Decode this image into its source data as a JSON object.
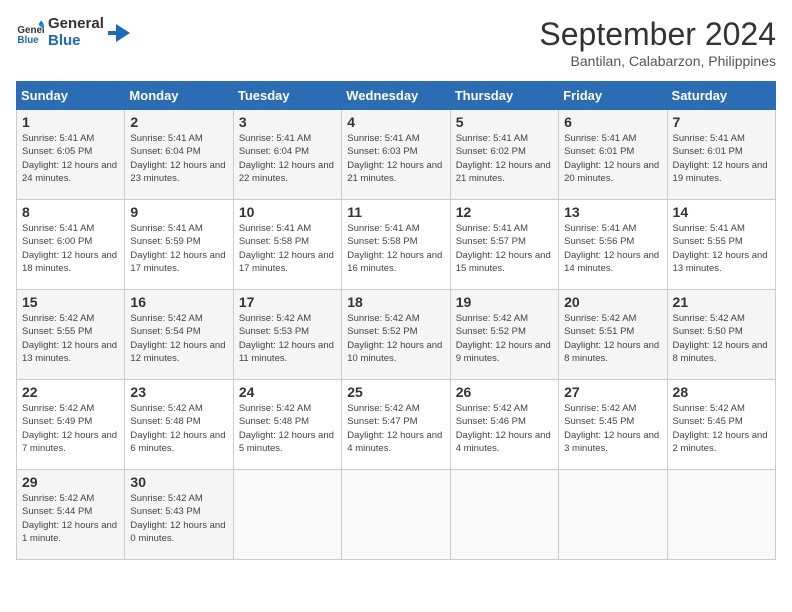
{
  "header": {
    "logo_line1": "General",
    "logo_line2": "Blue",
    "month": "September 2024",
    "location": "Bantilan, Calabarzon, Philippines"
  },
  "weekdays": [
    "Sunday",
    "Monday",
    "Tuesday",
    "Wednesday",
    "Thursday",
    "Friday",
    "Saturday"
  ],
  "weeks": [
    [
      {
        "day": "1",
        "sunrise": "5:41 AM",
        "sunset": "6:05 PM",
        "daylight": "12 hours and 24 minutes."
      },
      {
        "day": "2",
        "sunrise": "5:41 AM",
        "sunset": "6:04 PM",
        "daylight": "12 hours and 23 minutes."
      },
      {
        "day": "3",
        "sunrise": "5:41 AM",
        "sunset": "6:04 PM",
        "daylight": "12 hours and 22 minutes."
      },
      {
        "day": "4",
        "sunrise": "5:41 AM",
        "sunset": "6:03 PM",
        "daylight": "12 hours and 21 minutes."
      },
      {
        "day": "5",
        "sunrise": "5:41 AM",
        "sunset": "6:02 PM",
        "daylight": "12 hours and 21 minutes."
      },
      {
        "day": "6",
        "sunrise": "5:41 AM",
        "sunset": "6:01 PM",
        "daylight": "12 hours and 20 minutes."
      },
      {
        "day": "7",
        "sunrise": "5:41 AM",
        "sunset": "6:01 PM",
        "daylight": "12 hours and 19 minutes."
      }
    ],
    [
      {
        "day": "8",
        "sunrise": "5:41 AM",
        "sunset": "6:00 PM",
        "daylight": "12 hours and 18 minutes."
      },
      {
        "day": "9",
        "sunrise": "5:41 AM",
        "sunset": "5:59 PM",
        "daylight": "12 hours and 17 minutes."
      },
      {
        "day": "10",
        "sunrise": "5:41 AM",
        "sunset": "5:58 PM",
        "daylight": "12 hours and 17 minutes."
      },
      {
        "day": "11",
        "sunrise": "5:41 AM",
        "sunset": "5:58 PM",
        "daylight": "12 hours and 16 minutes."
      },
      {
        "day": "12",
        "sunrise": "5:41 AM",
        "sunset": "5:57 PM",
        "daylight": "12 hours and 15 minutes."
      },
      {
        "day": "13",
        "sunrise": "5:41 AM",
        "sunset": "5:56 PM",
        "daylight": "12 hours and 14 minutes."
      },
      {
        "day": "14",
        "sunrise": "5:41 AM",
        "sunset": "5:55 PM",
        "daylight": "12 hours and 13 minutes."
      }
    ],
    [
      {
        "day": "15",
        "sunrise": "5:42 AM",
        "sunset": "5:55 PM",
        "daylight": "12 hours and 13 minutes."
      },
      {
        "day": "16",
        "sunrise": "5:42 AM",
        "sunset": "5:54 PM",
        "daylight": "12 hours and 12 minutes."
      },
      {
        "day": "17",
        "sunrise": "5:42 AM",
        "sunset": "5:53 PM",
        "daylight": "12 hours and 11 minutes."
      },
      {
        "day": "18",
        "sunrise": "5:42 AM",
        "sunset": "5:52 PM",
        "daylight": "12 hours and 10 minutes."
      },
      {
        "day": "19",
        "sunrise": "5:42 AM",
        "sunset": "5:52 PM",
        "daylight": "12 hours and 9 minutes."
      },
      {
        "day": "20",
        "sunrise": "5:42 AM",
        "sunset": "5:51 PM",
        "daylight": "12 hours and 8 minutes."
      },
      {
        "day": "21",
        "sunrise": "5:42 AM",
        "sunset": "5:50 PM",
        "daylight": "12 hours and 8 minutes."
      }
    ],
    [
      {
        "day": "22",
        "sunrise": "5:42 AM",
        "sunset": "5:49 PM",
        "daylight": "12 hours and 7 minutes."
      },
      {
        "day": "23",
        "sunrise": "5:42 AM",
        "sunset": "5:48 PM",
        "daylight": "12 hours and 6 minutes."
      },
      {
        "day": "24",
        "sunrise": "5:42 AM",
        "sunset": "5:48 PM",
        "daylight": "12 hours and 5 minutes."
      },
      {
        "day": "25",
        "sunrise": "5:42 AM",
        "sunset": "5:47 PM",
        "daylight": "12 hours and 4 minutes."
      },
      {
        "day": "26",
        "sunrise": "5:42 AM",
        "sunset": "5:46 PM",
        "daylight": "12 hours and 4 minutes."
      },
      {
        "day": "27",
        "sunrise": "5:42 AM",
        "sunset": "5:45 PM",
        "daylight": "12 hours and 3 minutes."
      },
      {
        "day": "28",
        "sunrise": "5:42 AM",
        "sunset": "5:45 PM",
        "daylight": "12 hours and 2 minutes."
      }
    ],
    [
      {
        "day": "29",
        "sunrise": "5:42 AM",
        "sunset": "5:44 PM",
        "daylight": "12 hours and 1 minute."
      },
      {
        "day": "30",
        "sunrise": "5:42 AM",
        "sunset": "5:43 PM",
        "daylight": "12 hours and 0 minutes."
      },
      null,
      null,
      null,
      null,
      null
    ]
  ]
}
